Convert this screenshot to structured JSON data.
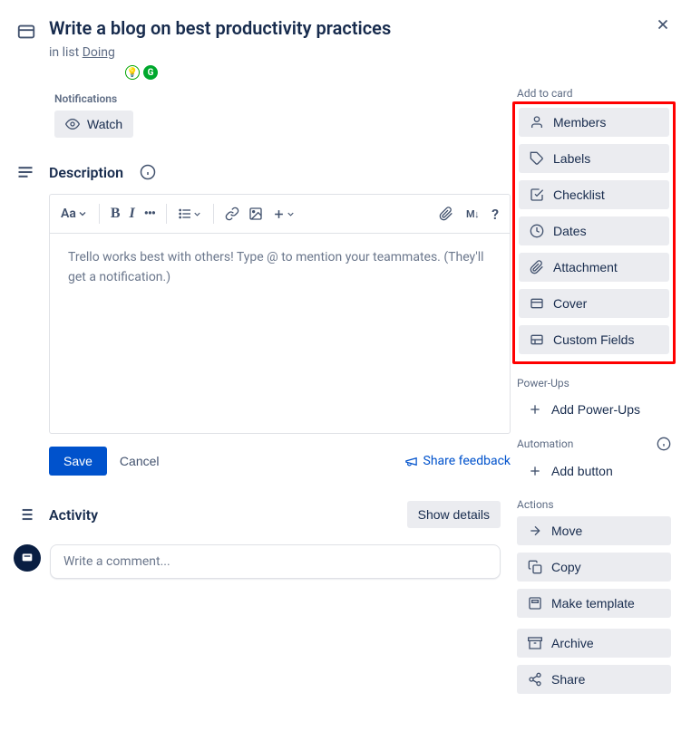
{
  "card": {
    "title": "Write a blog on best productivity practices",
    "inListPrefix": "in list ",
    "listName": "Doing"
  },
  "notifications": {
    "label": "Notifications",
    "watch": "Watch"
  },
  "description": {
    "label": "Description",
    "placeholder": "Trello works best with others! Type @ to mention your teammates. (They'll get a notification.)",
    "save": "Save",
    "cancel": "Cancel",
    "shareFeedback": "Share feedback",
    "toolbar": {
      "textStyle": "Aa",
      "bold": "B",
      "italic": "I",
      "markdown": "M↓",
      "help": "?"
    }
  },
  "activity": {
    "label": "Activity",
    "showDetails": "Show details",
    "commentPlaceholder": "Write a comment..."
  },
  "sidebar": {
    "addToCard": {
      "label": "Add to card",
      "members": "Members",
      "labels": "Labels",
      "checklist": "Checklist",
      "dates": "Dates",
      "attachment": "Attachment",
      "cover": "Cover",
      "customFields": "Custom Fields"
    },
    "powerUps": {
      "label": "Power-Ups",
      "add": "Add Power-Ups"
    },
    "automation": {
      "label": "Automation",
      "addButton": "Add button"
    },
    "actions": {
      "label": "Actions",
      "move": "Move",
      "copy": "Copy",
      "makeTemplate": "Make template",
      "archive": "Archive",
      "share": "Share"
    }
  }
}
